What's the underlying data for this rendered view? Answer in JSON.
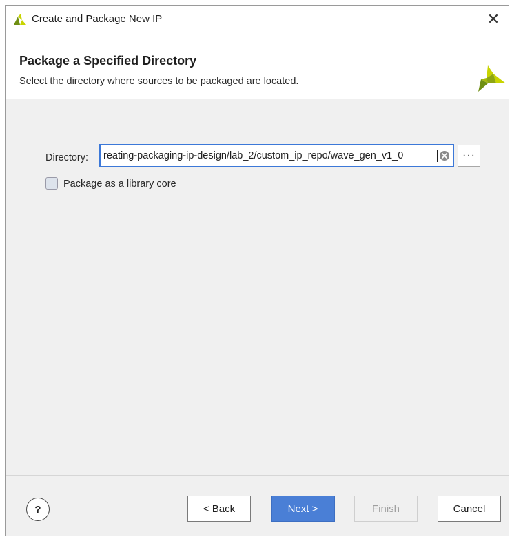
{
  "window": {
    "title": "Create and Package New IP",
    "close_glyph": "✕"
  },
  "header": {
    "title": "Package a Specified Directory",
    "subtitle": "Select the directory where sources to be packaged are located.",
    "logo_icon": "xilinx-logo-icon"
  },
  "form": {
    "directory_label": "Directory:",
    "directory_value": "reating-packaging-ip-design/lab_2/custom_ip_repo/wave_gen_v1_0",
    "browse_label": "···",
    "library_core_label": "Package as a library core",
    "library_core_checked": false
  },
  "footer": {
    "help_label": "?",
    "back_label": "< Back",
    "next_label": "Next >",
    "finish_label": "Finish",
    "cancel_label": "Cancel"
  },
  "colors": {
    "accent": "#4a7fd6",
    "input_focus": "#3c78d8",
    "logo_yellow": "#c8d400",
    "logo_green": "#6f8f12"
  }
}
